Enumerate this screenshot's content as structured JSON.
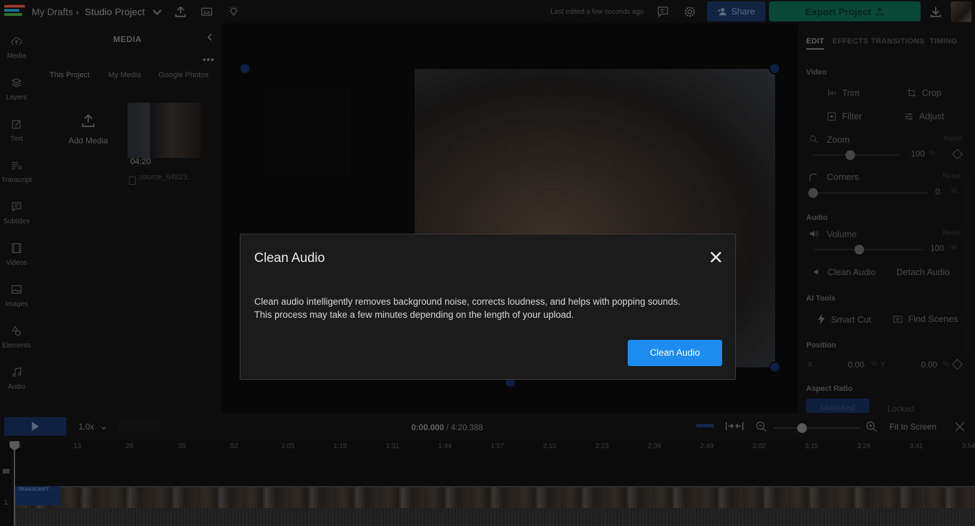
{
  "header": {
    "breadcrumb_root": "My Drafts",
    "breadcrumb_sep": "›",
    "project_name": "Studio Project",
    "last_edited": "Last edited a few seconds ago",
    "share_label": "Share",
    "export_label": "Export Project"
  },
  "left_nav": {
    "items": [
      {
        "label": "Media",
        "icon": "cloud-upload-icon"
      },
      {
        "label": "Layers",
        "icon": "layers-icon"
      },
      {
        "label": "Text",
        "icon": "text-edit-icon"
      },
      {
        "label": "Transcript",
        "icon": "transcript-icon"
      },
      {
        "label": "Subtitles",
        "icon": "subtitles-icon"
      },
      {
        "label": "Videos",
        "icon": "film-icon"
      },
      {
        "label": "Images",
        "icon": "image-icon"
      },
      {
        "label": "Elements",
        "icon": "shapes-icon"
      },
      {
        "label": "Audio",
        "icon": "music-note-icon"
      }
    ]
  },
  "media_panel": {
    "title": "MEDIA",
    "tabs": [
      "This Project",
      "My Media",
      "Google Photos"
    ],
    "add_media": "Add Media",
    "thumb_duration": "04:20",
    "thumb_name": "source_64823..."
  },
  "right_panel": {
    "tabs": [
      "EDIT",
      "EFFECTS",
      "TRANSITIONS",
      "TIMING"
    ],
    "video_section": "Video",
    "trim": "Trim",
    "crop": "Crop",
    "filter": "Filter",
    "adjust": "Adjust",
    "zoom_label": "Zoom",
    "zoom_value": "100",
    "zoom_percent": 100,
    "corners_label": "Corners",
    "corners_value": "0",
    "corners_percent": 0,
    "reset": "Reset",
    "unit_percent": "%",
    "audio_section": "Audio",
    "volume_label": "Volume",
    "volume_value": "100",
    "volume_percent": 100,
    "clean_audio": "Clean Audio",
    "detach_audio": "Detach Audio",
    "ai_section": "AI Tools",
    "smart_cut": "Smart Cut",
    "find_scenes": "Find Scenes",
    "position_section": "Position",
    "x_label": "X",
    "x_value": "0.00",
    "y_label": "Y",
    "y_value": "0.00",
    "aspect_section": "Aspect Ratio",
    "unlocked": "Unlocked",
    "locked": "Locked"
  },
  "playback": {
    "speed": "1.0x",
    "current_time": "0:00.000",
    "total_time": "/ 4:20.388",
    "fit_to_screen": "Fit to Screen"
  },
  "timeline": {
    "ticks": [
      ":0",
      ":13",
      ":26",
      ":39",
      ":52",
      "1:05",
      "1:18",
      "1:31",
      "1:44",
      "1:57",
      "2:10",
      "2:23",
      "2:36",
      "2:49",
      "3:02",
      "3:15",
      "3:28",
      "3:41",
      "3:54"
    ],
    "transcript_tag": "TRANSCRIPT",
    "track_number": "1"
  },
  "modal": {
    "title": "Clean Audio",
    "body_line1": "Clean audio intelligently removes background noise, corrects loudness, and helps with popping sounds.",
    "body_line2": "This process may take a few minutes depending on the length of your upload.",
    "cta": "Clean Audio"
  },
  "colors": {
    "accent_blue": "#1d8cf0",
    "export_green": "#0e6d55",
    "share_blue": "#1b3a66"
  }
}
